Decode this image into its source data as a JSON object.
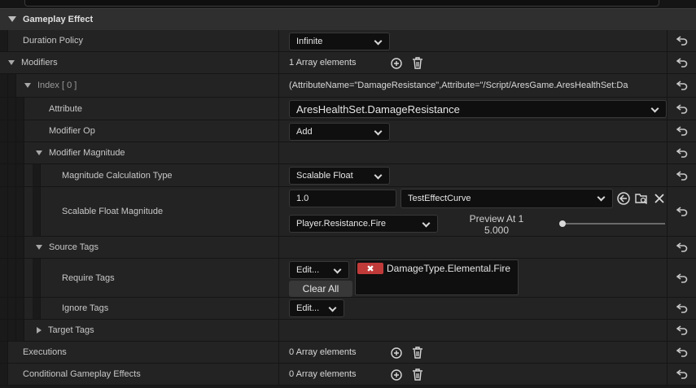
{
  "section": {
    "title": "Gameplay Effect"
  },
  "rows": {
    "duration_policy": {
      "label": "Duration Policy",
      "value": "Infinite"
    },
    "modifiers": {
      "label": "Modifiers",
      "value": "1 Array elements"
    },
    "index0": {
      "label": "Index [ 0 ]",
      "value": "(AttributeName=\"DamageResistance\",Attribute=\"/Script/AresGame.AresHealthSet:Da"
    },
    "attribute": {
      "label": "Attribute",
      "value": "AresHealthSet.DamageResistance"
    },
    "modifier_op": {
      "label": "Modifier Op",
      "value": "Add"
    },
    "modifier_magnitude": {
      "label": "Modifier Magnitude"
    },
    "magnitude_calc_type": {
      "label": "Magnitude Calculation Type",
      "value": "Scalable Float"
    },
    "scalable_float_magnitude": {
      "label": "Scalable Float Magnitude",
      "value": "1.0",
      "curve": "TestEffectCurve",
      "row_name": "Player.Resistance.Fire",
      "preview_label": "Preview At 1",
      "preview_value": "5.000",
      "preview_slider_fraction": 0.0
    },
    "source_tags": {
      "label": "Source Tags"
    },
    "require_tags": {
      "label": "Require Tags",
      "edit_label": "Edit...",
      "clear_label": "Clear All",
      "tag": "DamageType.Elemental.Fire"
    },
    "ignore_tags": {
      "label": "Ignore Tags",
      "edit_label": "Edit..."
    },
    "target_tags": {
      "label": "Target Tags"
    },
    "executions": {
      "label": "Executions",
      "value": "0 Array elements"
    },
    "conditional_effects": {
      "label": "Conditional Gameplay Effects",
      "value": "0 Array elements"
    }
  },
  "icons": {
    "reset": "reset-arrow-icon",
    "add": "plus-circle-icon",
    "delete": "trash-icon",
    "use_selected": "arrow-left-circle-icon",
    "browse": "folder-search-icon",
    "clear": "close-icon"
  },
  "colors": {
    "tag_remove": "#c03a3a",
    "panel": "#232323",
    "input": "#0f0f0f"
  }
}
